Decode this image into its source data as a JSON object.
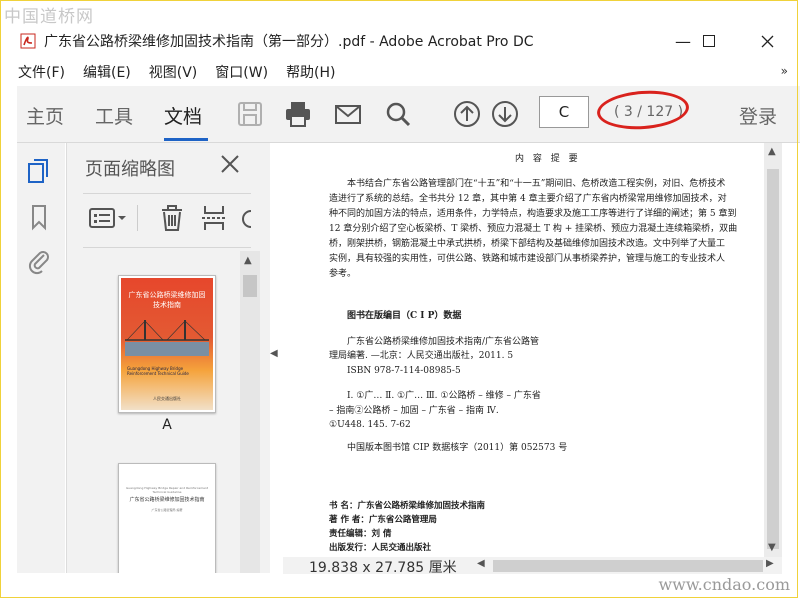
{
  "watermarks": {
    "top": "中国道桥网",
    "bottom": "www.cndao.com"
  },
  "window": {
    "title": "广东省公路桥梁维修加固技术指南（第一部分）.pdf - Adobe Acrobat Pro DC",
    "controls": {
      "minimize": "—",
      "maximize": "☐",
      "close": "✕"
    }
  },
  "menu": {
    "items": [
      "文件(F)",
      "编辑(E)",
      "视图(V)",
      "窗口(W)",
      "帮助(H)"
    ],
    "more": "»"
  },
  "toolbar": {
    "tabs": [
      "主页",
      "工具",
      "文档"
    ],
    "active_tab": "文档",
    "page_input_value": "C",
    "page_count": "( 3 / 127 )",
    "login": "登录",
    "icons": [
      "save-icon",
      "print-icon",
      "email-icon",
      "search-icon",
      "prev-page-icon",
      "next-page-icon"
    ]
  },
  "left_rail": {
    "icons": [
      "page-thumbnails-icon",
      "bookmark-icon",
      "attachment-icon"
    ]
  },
  "thumbnail_panel": {
    "title": "页面缩略图",
    "tools": [
      "options-icon",
      "delete-icon",
      "insert-page-icon",
      "rotate-icon"
    ],
    "thumbs": [
      {
        "label": "A",
        "cover_title": "广东省公路桥梁维修加固技术指南",
        "cover_en": "Guangdong Highway Bridge Reinforcement Technical Guide",
        "cover_pub": "人民交通出版社"
      },
      {
        "label": "",
        "line1": "Guangdong Highway Bridge Repair and Reinforcement Technical Guideline",
        "line2": "广东省公路桥梁维修加固技术指南",
        "line3": "广东省公路管理局 编著"
      }
    ]
  },
  "document": {
    "header": "内 容 提 要",
    "intro_lines": [
      "本书结合广东省公路管理部门在“十五”和“十一五”期间旧、危桥改造工程实例，对旧、危桥技术",
      "造进行了系统的总结。全书共分 12 章，其中第 4 章主要介绍了广东省内桥梁常用维修加固技术，对",
      "种不同的加固方法的特点，适用条件，力学特点，构造要求及施工工序等进行了详细的阐述；第 5 章到",
      "12 章分别介绍了空心板梁桥、T 梁桥、预应力混凝土 T 构 + 挂梁桥、预应力混凝土连续箱梁桥，双曲",
      "桥，刚架拱桥，钢筋混凝土中承式拱桥，桥梁下部结构及基础维修加固技术改造。文中列举了大量工",
      "实例，具有较强的实用性，可供公路、铁路和城市建设部门从事桥梁养护，管理与施工的专业技术人",
      "参考。"
    ],
    "cip_heading": "图书在版编目（C I P）数据",
    "cip_lines": [
      "广东省公路桥梁维修加固技术指南/广东省公路管",
      "理局编著. —北京：人民交通出版社，2011. 5",
      "ISBN 978-7-114-08985-5",
      "Ⅰ. ①广…   Ⅱ. ①广…   Ⅲ. ①公路桥 – 维修 – 广东省",
      "– 指南②公路桥 – 加固 – 广东省 – 指南   Ⅳ.",
      "①U448. 145. 7-62",
      "中国版本图书馆 CIP 数据核字（2011）第 052573 号"
    ],
    "info_lines": [
      "书      名：广东省公路桥梁维修加固技术指南",
      "著 作 者：广东省公路管理局",
      "责任编辑：刘   倩",
      "出版发行：人民交通出版社"
    ]
  },
  "status": {
    "dimensions": "19.838 x 27.785 厘米"
  }
}
